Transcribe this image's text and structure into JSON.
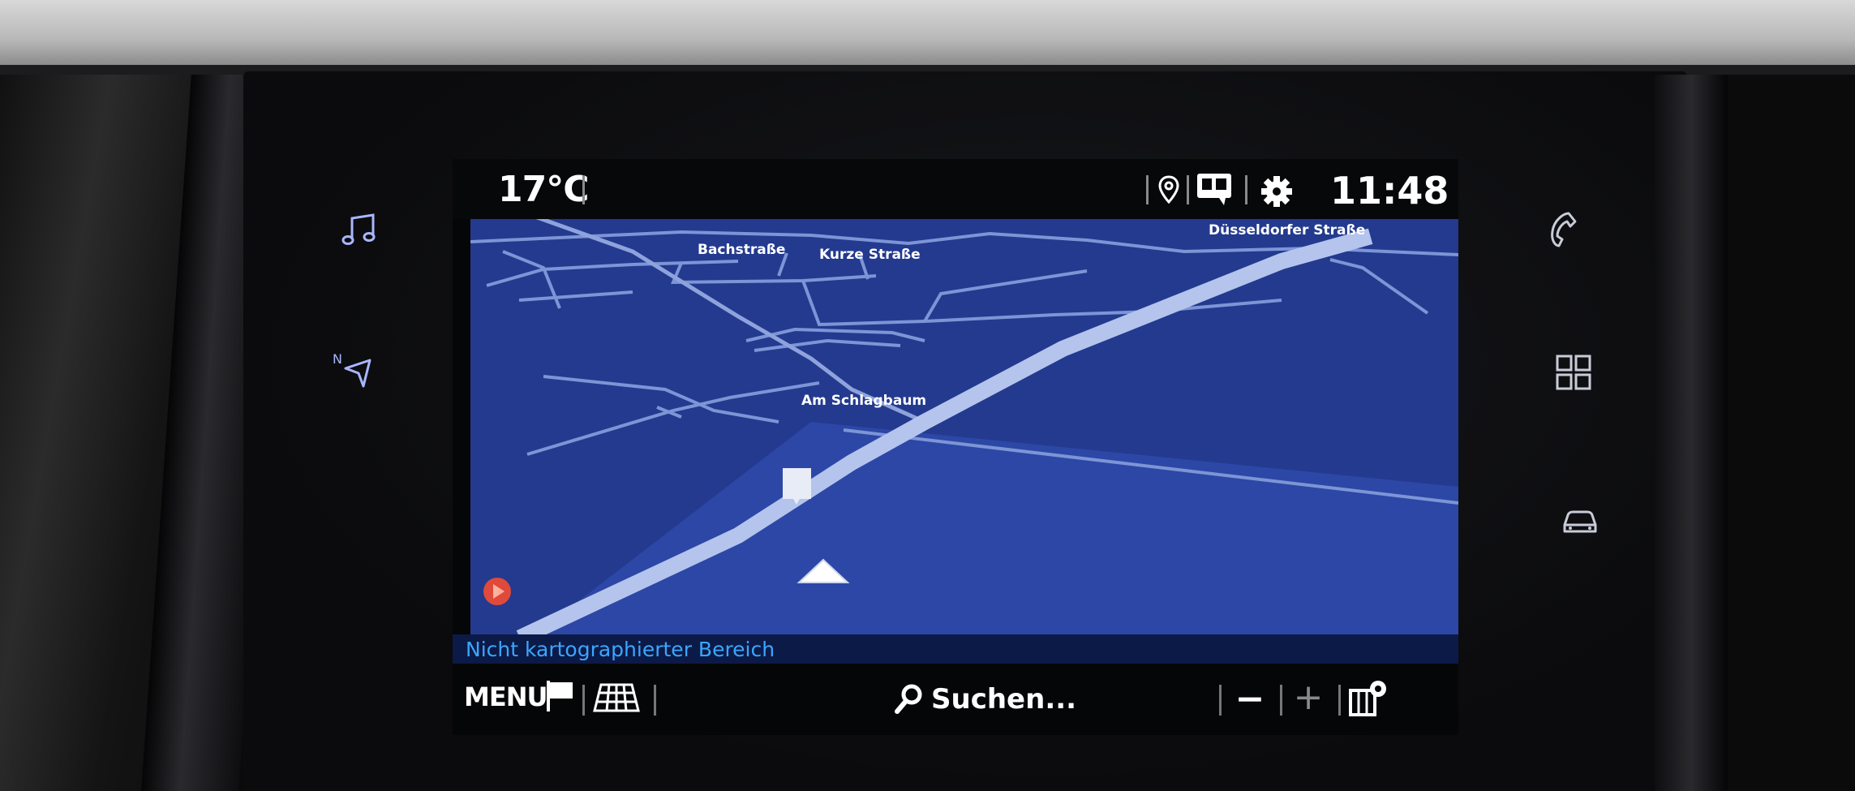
{
  "status": {
    "temperature": "17°C",
    "time": "11:48"
  },
  "map": {
    "streets": [
      "Bachstraße",
      "Kurze Straße",
      "Düsseldorfer Straße",
      "Am Schlagbaum"
    ],
    "info_text": "Nicht kartographierter Bereich"
  },
  "bottom": {
    "menu_label": "MENU",
    "search_placeholder": "Suchen...",
    "zoom_out": "−",
    "zoom_in": "+"
  },
  "hardkeys": {
    "left": [
      "music-icon",
      "navigation-icon"
    ],
    "right": [
      "phone-icon",
      "apps-grid-icon",
      "car-icon"
    ]
  },
  "colors": {
    "map_background": "#233a8f",
    "road": "#7d95d6",
    "main_road": "#b4c4ec",
    "info_text": "#3aa6ff"
  }
}
